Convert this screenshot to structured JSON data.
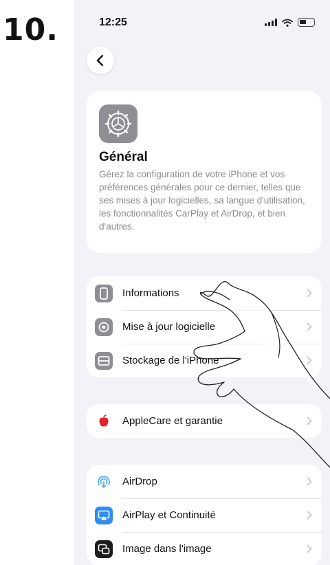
{
  "step_number": "10.",
  "status_bar": {
    "time": "12:25"
  },
  "hero": {
    "title": "Général",
    "description": "Gérez la configuration de votre iPhone et vos préférences générales pour ce dernier, telles que ses mises à jour logicielles, sa langue d'utilisation, les fonctionnalités CarPlay et AirDrop, et bien d'autres."
  },
  "group1": {
    "items": [
      {
        "label": "Informations",
        "icon": "phone-info-icon"
      },
      {
        "label": "Mise à jour logicielle",
        "icon": "gear-update-icon"
      },
      {
        "label": "Stockage de l'iPhone",
        "icon": "storage-icon"
      }
    ]
  },
  "group2": {
    "items": [
      {
        "label": "AppleCare et garantie",
        "icon": "apple-logo-icon"
      }
    ]
  },
  "group3": {
    "items": [
      {
        "label": "AirDrop",
        "icon": "airdrop-icon"
      },
      {
        "label": "AirPlay et Continuité",
        "icon": "airplay-icon"
      },
      {
        "label": "Image dans l'image",
        "icon": "picture-in-picture-icon"
      }
    ]
  },
  "colors": {
    "background": "#f2f2f7",
    "card": "#ffffff",
    "gray_icon": "#8e8e93",
    "apple_red": "#e0242b",
    "airdrop_blue": "#60b3f0",
    "airplay_blue": "#2f8cf0",
    "pip_dark": "#1c1c1e"
  }
}
